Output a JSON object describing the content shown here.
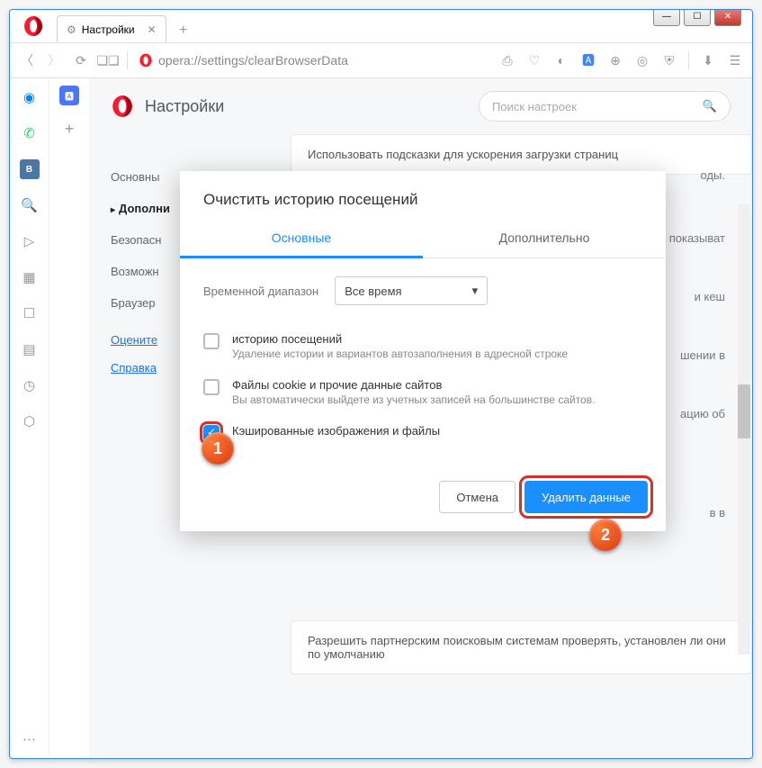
{
  "window": {
    "title": "Настройки"
  },
  "addressbar": {
    "url": "opera://settings/clearBrowserData"
  },
  "sidebar_apps": {
    "items": [
      "messenger",
      "whatsapp",
      "vk",
      "search",
      "send",
      "grid",
      "bookmark",
      "doc",
      "clock",
      "cube"
    ]
  },
  "page": {
    "title": "Настройки",
    "search_placeholder": "Поиск настроек"
  },
  "leftnav": {
    "items": [
      "Основны",
      "Дополни",
      "Безопасн",
      "Возможн",
      "Браузер"
    ],
    "selected_index": 1,
    "links": [
      "Оцените",
      "Справка"
    ]
  },
  "background_cards": [
    "Использовать подсказки для ускорения загрузки страниц",
    "оды.",
    "нт показыват",
    "и кеш",
    "шении в",
    "ацию об",
    "в в",
    "Разрешить партнерским поисковым системам проверять, установлен ли они по умолчанию"
  ],
  "dialog": {
    "title": "Очистить историю посещений",
    "tabs": [
      "Основные",
      "Дополнительно"
    ],
    "active_tab": 0,
    "range_label": "Временной диапазон",
    "range_value": "Все время",
    "options": [
      {
        "checked": false,
        "title": "историю посещений",
        "sub": "Удаление истории и вариантов автозаполнения в адресной строке"
      },
      {
        "checked": false,
        "title": "Файлы cookie и прочие данные сайтов",
        "sub": "Вы автоматически выйдете из учетных записей на большинстве сайтов."
      },
      {
        "checked": true,
        "title": "Кэшированные изображения и файлы",
        "sub": ""
      }
    ],
    "cancel": "Отмена",
    "confirm": "Удалить данные"
  },
  "badges": {
    "one": "1",
    "two": "2"
  }
}
